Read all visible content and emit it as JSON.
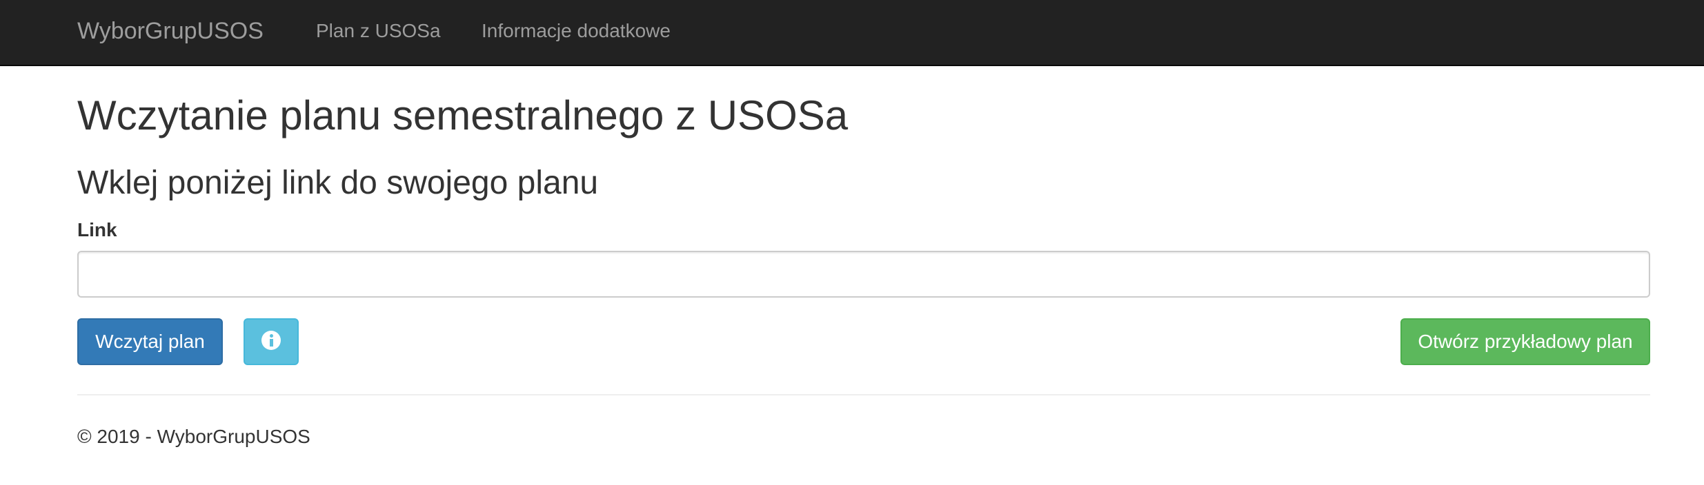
{
  "navbar": {
    "brand": "WyborGrupUSOS",
    "links": [
      {
        "label": "Plan z USOSa"
      },
      {
        "label": "Informacje dodatkowe"
      }
    ]
  },
  "main": {
    "title": "Wczytanie planu semestralnego z USOSa",
    "subtitle": "Wklej poniżej link do swojego planu",
    "link_label": "Link",
    "link_value": "",
    "link_placeholder": "",
    "buttons": {
      "load": "Wczytaj plan",
      "info_icon": "info-circle-icon",
      "example": "Otwórz przykładowy plan"
    }
  },
  "footer": {
    "text": "© 2019 - WyborGrupUSOS"
  },
  "colors": {
    "navbar_bg": "#222222",
    "primary": "#337ab7",
    "info": "#5bc0de",
    "success": "#5cb85c"
  }
}
